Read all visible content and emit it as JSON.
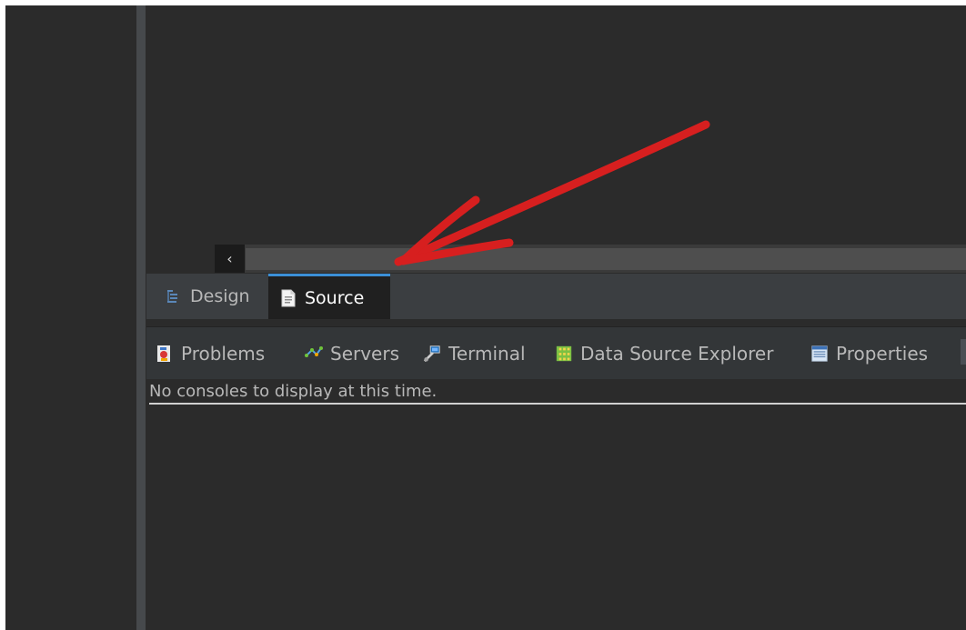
{
  "editor": {
    "scroll_left_glyph": "‹"
  },
  "editor_tabs": [
    {
      "label": "Design",
      "icon": "design-icon"
    },
    {
      "label": "Source",
      "icon": "source-icon",
      "active": true
    }
  ],
  "views": [
    {
      "label": "Problems",
      "icon": "problems-icon"
    },
    {
      "label": "Servers",
      "icon": "servers-icon"
    },
    {
      "label": "Terminal",
      "icon": "terminal-icon"
    },
    {
      "label": "Data Source Explorer",
      "icon": "data-source-explorer-icon"
    },
    {
      "label": "Properties",
      "icon": "properties-icon"
    }
  ],
  "console": {
    "message": "No consoles to display at this time."
  },
  "colors": {
    "background": "#2b2b2b",
    "active_tab_accent": "#3b8fd7",
    "annotation_arrow": "#d71f1f"
  }
}
